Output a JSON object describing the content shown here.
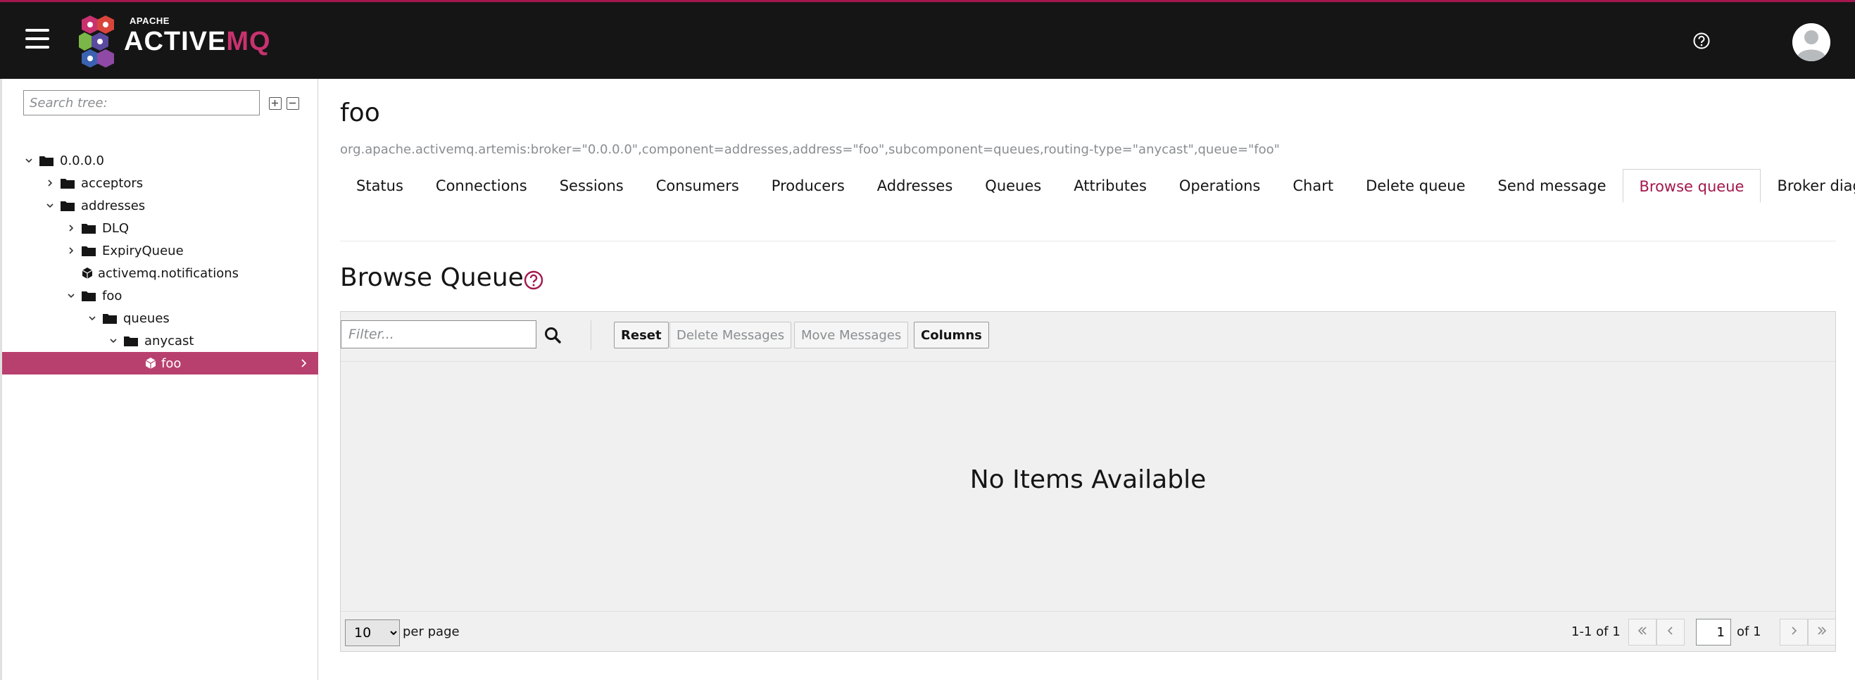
{
  "header": {
    "logo_apache": "APACHE",
    "logo_active": "ACTIVE",
    "logo_mq": "MQ",
    "colors": {
      "bar": "#151515",
      "accent": "#a3174d"
    }
  },
  "sidebar": {
    "search_placeholder": "Search tree:",
    "items": [
      {
        "label": "0.0.0.0",
        "icon": "folder-icon",
        "expanded": true
      },
      {
        "label": "acceptors",
        "icon": "folder-icon",
        "expanded": false
      },
      {
        "label": "addresses",
        "icon": "folder-icon",
        "expanded": true
      },
      {
        "label": "DLQ",
        "icon": "folder-icon",
        "expanded": false
      },
      {
        "label": "ExpiryQueue",
        "icon": "folder-icon",
        "expanded": false
      },
      {
        "label": "activemq.notifications",
        "icon": "cube-icon"
      },
      {
        "label": "foo",
        "icon": "folder-icon",
        "expanded": true
      },
      {
        "label": "queues",
        "icon": "folder-icon",
        "expanded": true
      },
      {
        "label": "anycast",
        "icon": "folder-icon",
        "expanded": true
      },
      {
        "label": "foo",
        "icon": "cube-icon",
        "selected": true
      }
    ]
  },
  "main": {
    "title": "foo",
    "mbean": "org.apache.activemq.artemis:broker=\"0.0.0.0\",component=addresses,address=\"foo\",subcomponent=queues,routing-type=\"anycast\",queue=\"foo\"",
    "tabs": [
      "Status",
      "Connections",
      "Sessions",
      "Consumers",
      "Producers",
      "Addresses",
      "Queues",
      "Attributes",
      "Operations",
      "Chart",
      "Delete queue",
      "Send message",
      "Browse queue",
      "Broker diagram"
    ],
    "active_tab": "Browse queue",
    "section_title": "Browse Queue",
    "toolbar": {
      "filter_placeholder": "Filter...",
      "reset": "Reset",
      "delete_messages": "Delete Messages",
      "move_messages": "Move Messages",
      "columns": "Columns"
    },
    "empty_text": "No Items Available",
    "pager": {
      "per_page_value": "10",
      "per_page_label": "per page",
      "range": "1-1 of 1",
      "page": "1",
      "of_pages": "of 1"
    }
  }
}
